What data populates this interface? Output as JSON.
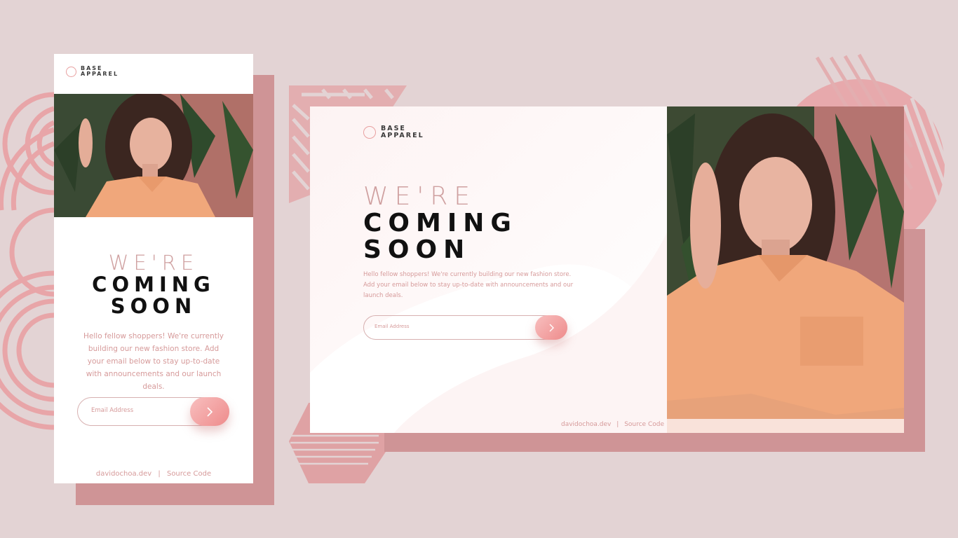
{
  "brand": {
    "line1": "BASE",
    "line2": "APPAREL"
  },
  "heading": {
    "light": "WE'RE",
    "dark_line1": "COMING",
    "dark_line2": "SOON"
  },
  "description": "Hello fellow shoppers! We're currently building our new fashion store. Add your email below to stay up-to-date with announcements and our launch deals.",
  "form": {
    "placeholder": "Email Address",
    "submit_icon": "chevron-right-icon"
  },
  "footer": {
    "site": "davidochoa.dev",
    "separator": "|",
    "source": "Source Code"
  },
  "photo": {
    "description_icon": "model-photo"
  },
  "colors": {
    "background": "#e3d3d4",
    "accent": "#cf9496",
    "pink_text": "#d69a9a",
    "heading_light": "#cfa0a0",
    "button_start": "#f8bfbf",
    "button_end": "#ee8b8b"
  }
}
